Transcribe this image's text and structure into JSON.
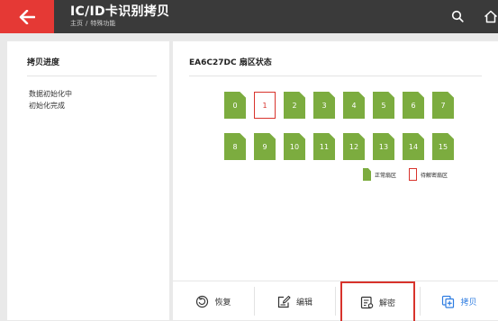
{
  "header": {
    "title": "IC/ID卡识别拷贝",
    "breadcrumb": [
      "主页",
      "/",
      "特殊功能"
    ]
  },
  "left_panel": {
    "title": "拷贝进度",
    "log": [
      "数据初始化中",
      "初始化完成"
    ]
  },
  "right_panel": {
    "title": "EA6C27DC 扇区状态",
    "sectors": [
      {
        "label": "0",
        "status": "normal"
      },
      {
        "label": "1",
        "status": "pending"
      },
      {
        "label": "2",
        "status": "normal"
      },
      {
        "label": "3",
        "status": "normal"
      },
      {
        "label": "4",
        "status": "normal"
      },
      {
        "label": "5",
        "status": "normal"
      },
      {
        "label": "6",
        "status": "normal"
      },
      {
        "label": "7",
        "status": "normal"
      },
      {
        "label": "8",
        "status": "normal"
      },
      {
        "label": "9",
        "status": "normal"
      },
      {
        "label": "10",
        "status": "normal"
      },
      {
        "label": "11",
        "status": "normal"
      },
      {
        "label": "12",
        "status": "normal"
      },
      {
        "label": "13",
        "status": "normal"
      },
      {
        "label": "14",
        "status": "normal"
      },
      {
        "label": "15",
        "status": "normal"
      }
    ],
    "legend": {
      "normal": "正常扇区",
      "pending": "待解密扇区"
    }
  },
  "toolbar": {
    "restore": "恢复",
    "edit": "编辑",
    "decrypt": "解密",
    "copy": "拷贝"
  },
  "colors": {
    "accent_red": "#e53935",
    "sector_green": "#7cac3f",
    "pending_red": "#d8332c",
    "primary_blue": "#2f7de1",
    "topbar": "#3a3a3a"
  }
}
